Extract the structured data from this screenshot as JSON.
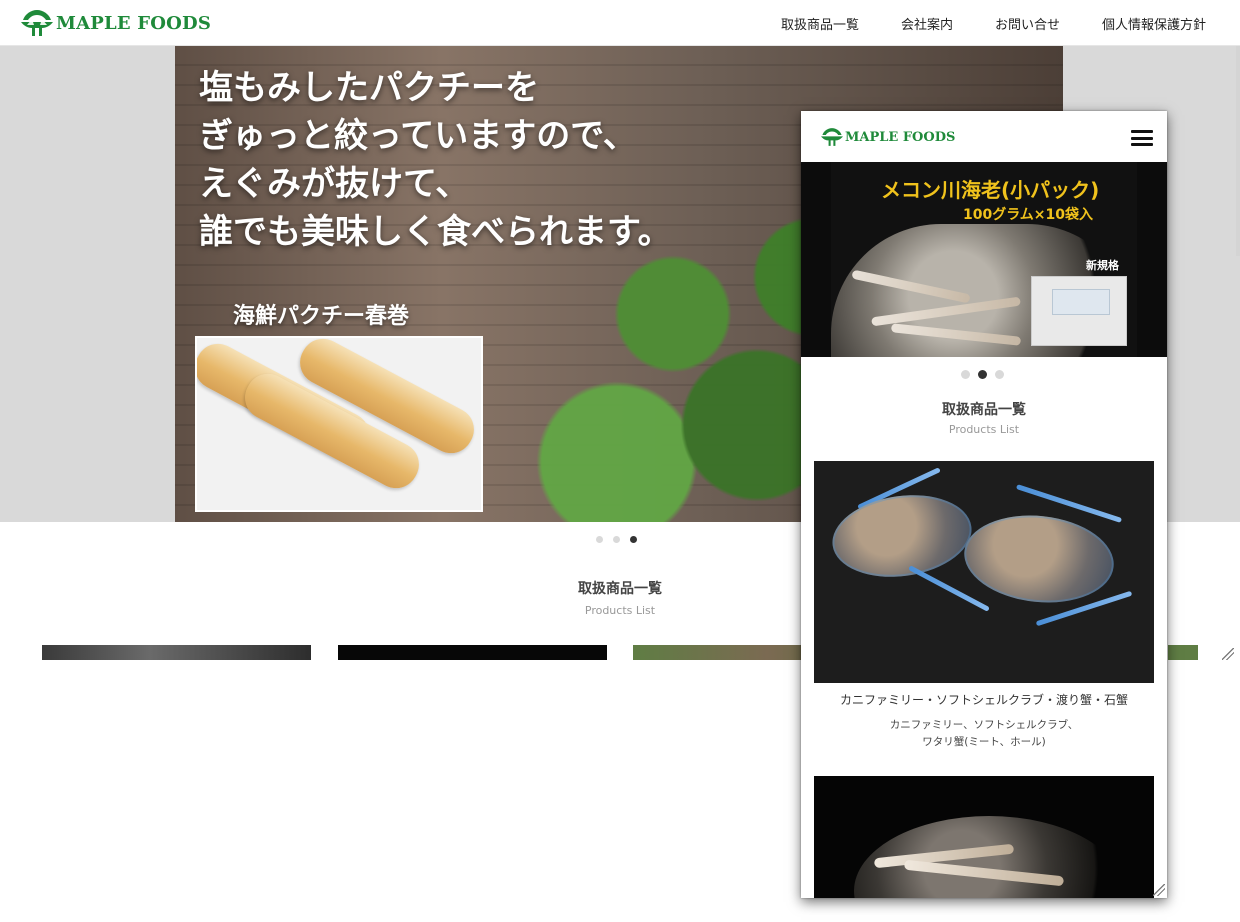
{
  "header": {
    "brand": "MAPLE FOODS",
    "nav": [
      "取扱商品一覧",
      "会社案内",
      "お問い合せ",
      "個人情報保護方針"
    ]
  },
  "hero": {
    "headline": [
      "塩もみしたパクチーを",
      "ぎゅっと絞っていますので、",
      "えぐみが抜けて、",
      "誰でも美味しく食べられます。"
    ],
    "sublabel": "海鮮パクチー春巻",
    "active_slide": 3,
    "slide_count": 3
  },
  "products_section": {
    "title": "取扱商品一覧",
    "subtitle": "Products List"
  },
  "mobile": {
    "brand": "MAPLE FOODS",
    "banner": {
      "title": "メコン川海老(小パック)",
      "subtitle": "100グラム×10袋入",
      "tag": "新規格"
    },
    "active_slide": 2,
    "slide_count": 3,
    "section_title": "取扱商品一覧",
    "section_subtitle": "Products List",
    "card1": {
      "title": "カニファミリー・ソフトシェルクラブ・渡り蟹・石蟹",
      "desc_line1": "カニファミリー、ソフトシェルクラブ、",
      "desc_line2": "ワタリ蟹(ミート、ホール)"
    }
  },
  "colors": {
    "brand_green": "#1f8a3a",
    "banner_yellow": "#f0c21c",
    "dot_active": "#333333",
    "dot_inactive": "#d9d9d9"
  },
  "icons": [
    "maple-leaf-logo-icon",
    "hamburger-menu-icon",
    "resize-grip-icon"
  ]
}
